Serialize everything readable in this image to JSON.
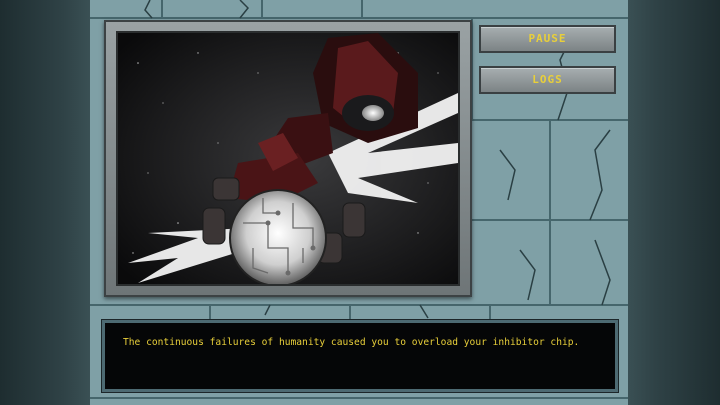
{
  "buttons": {
    "pause_label": "PAUSE",
    "logs_label": "LOGS"
  },
  "dialog": {
    "text": "The continuous failures of humanity caused you to overload your inhibitor chip."
  },
  "colors": {
    "text_yellow": "#e8cf3a",
    "wall": "#7fa0a6",
    "dialog_bg": "#050607"
  },
  "scene": {
    "description_icon": "robot-crushing-earth-illustration"
  }
}
